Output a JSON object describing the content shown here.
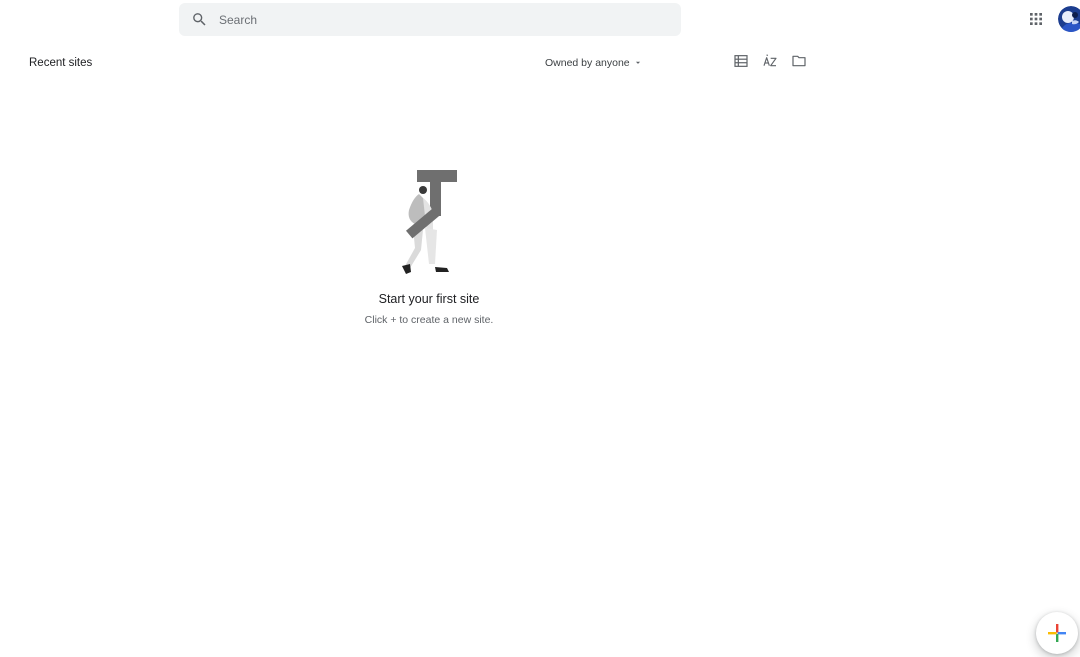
{
  "search": {
    "placeholder": "Search",
    "value": ""
  },
  "header": {
    "apps_icon": "apps-grid-icon",
    "avatar_icon": "account-avatar"
  },
  "main": {
    "section_title": "Recent sites",
    "owner_filter": "Owned by anyone",
    "toolbar_icons": [
      "list-view-icon",
      "sort-az-icon",
      "folder-icon"
    ]
  },
  "empty_state": {
    "title": "Start your first site",
    "subtitle": "Click + to create a new site."
  },
  "colors": {
    "google_blue": "#4285F4",
    "google_red": "#EA4335",
    "google_yellow": "#FBBC04",
    "google_green": "#34A853",
    "search_bg": "#f1f3f4"
  }
}
